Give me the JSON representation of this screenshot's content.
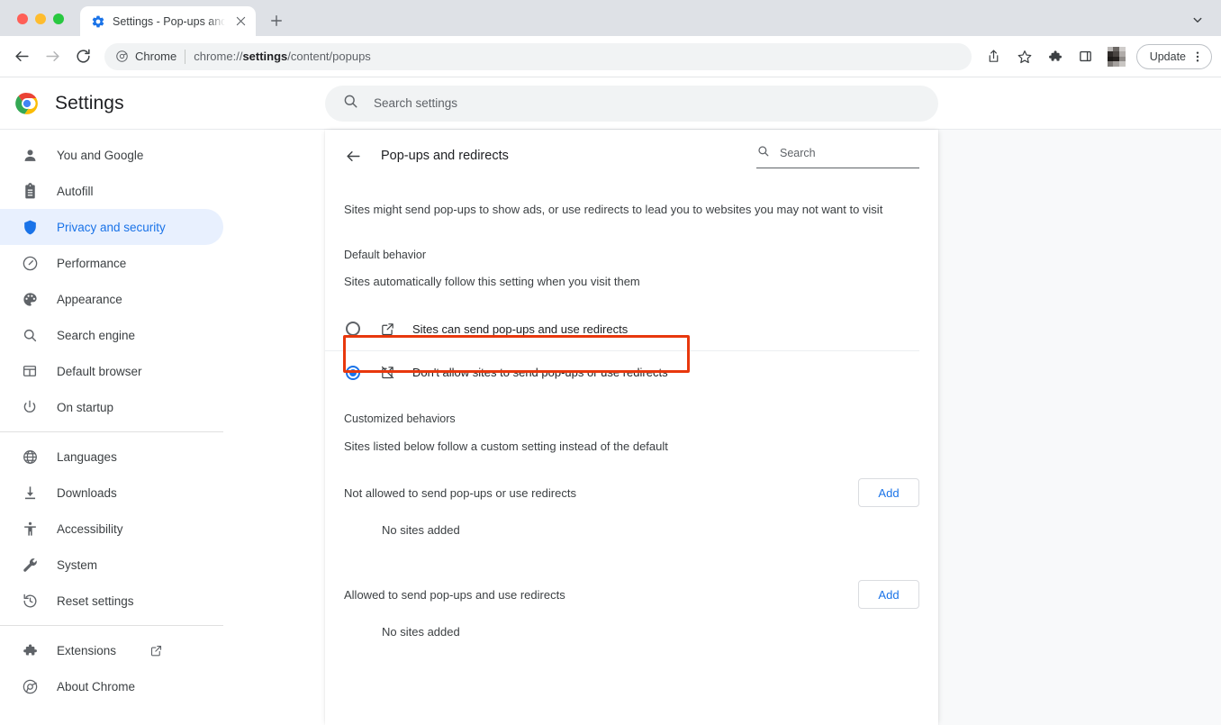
{
  "window": {
    "tab": {
      "favicon": "settings-gear-icon",
      "title": "Settings - Pop-ups and redirec",
      "close_label": "×"
    },
    "new_tab_label": "+",
    "tab_search_icon": "chevron-down-icon"
  },
  "toolbar": {
    "back_icon": "back-arrow-icon",
    "forward_icon": "forward-arrow-icon",
    "reload_icon": "reload-icon",
    "omnibox": {
      "chrome_label": "Chrome",
      "url_prefix": "chrome://",
      "url_bold": "settings",
      "url_suffix": "/content/popups",
      "full_url": "chrome://settings/content/popups"
    },
    "share_icon": "share-icon",
    "bookmark_icon": "star-icon",
    "extensions_icon": "puzzle-icon",
    "side_panel_icon": "side-panel-icon",
    "avatar_icon": "profile-avatar",
    "update_label": "Update",
    "menu_icon": "three-dot-menu-icon"
  },
  "settings_header": {
    "logo": "chrome-logo",
    "title": "Settings",
    "search_icon": "search-icon",
    "search_placeholder": "Search settings",
    "search_value": ""
  },
  "sidebar": {
    "items": [
      {
        "label": "You and Google",
        "icon": "person-icon",
        "selected": false
      },
      {
        "label": "Autofill",
        "icon": "clipboard-icon",
        "selected": false
      },
      {
        "label": "Privacy and security",
        "icon": "shield-icon",
        "selected": true
      },
      {
        "label": "Performance",
        "icon": "speedometer-icon",
        "selected": false
      },
      {
        "label": "Appearance",
        "icon": "palette-icon",
        "selected": false
      },
      {
        "label": "Search engine",
        "icon": "search-icon",
        "selected": false
      },
      {
        "label": "Default browser",
        "icon": "browser-window-icon",
        "selected": false
      },
      {
        "label": "On startup",
        "icon": "power-icon",
        "selected": false
      }
    ],
    "group2": [
      {
        "label": "Languages",
        "icon": "globe-icon"
      },
      {
        "label": "Downloads",
        "icon": "download-icon"
      },
      {
        "label": "Accessibility",
        "icon": "accessibility-icon"
      },
      {
        "label": "System",
        "icon": "wrench-icon"
      },
      {
        "label": "Reset settings",
        "icon": "history-restore-icon"
      }
    ],
    "group3": [
      {
        "label": "Extensions",
        "icon": "puzzle-icon",
        "external": true
      },
      {
        "label": "About Chrome",
        "icon": "chrome-icon",
        "external": false
      }
    ]
  },
  "main": {
    "back_icon": "back-arrow-icon",
    "title": "Pop-ups and redirects",
    "search_icon": "search-icon",
    "search_placeholder": "Search",
    "search_value": "",
    "intro": "Sites might send pop-ups to show ads, or use redirects to lead you to websites you may not want to visit",
    "default_behavior": {
      "heading": "Default behavior",
      "description": "Sites automatically follow this setting when you visit them",
      "options": [
        {
          "label": "Sites can send pop-ups and use redirects",
          "icon": "open-in-new-icon",
          "selected": false,
          "highlighted": false
        },
        {
          "label": "Don't allow sites to send pop-ups or use redirects",
          "icon": "open-in-new-off-icon",
          "selected": true,
          "highlighted": true
        }
      ]
    },
    "customized_behaviors": {
      "heading": "Customized behaviors",
      "description": "Sites listed below follow a custom setting instead of the default",
      "lists": [
        {
          "label": "Not allowed to send pop-ups or use redirects",
          "add_label": "Add",
          "empty_label": "No sites added"
        },
        {
          "label": "Allowed to send pop-ups and use redirects",
          "add_label": "Add",
          "empty_label": "No sites added"
        }
      ]
    }
  },
  "colors": {
    "accent_blue": "#1a73e8",
    "selected_nav_bg": "#e8f0fe",
    "highlight_red": "#e8380d",
    "page_bg": "#f8f9fa",
    "tabstrip_bg": "#dee1e6"
  }
}
